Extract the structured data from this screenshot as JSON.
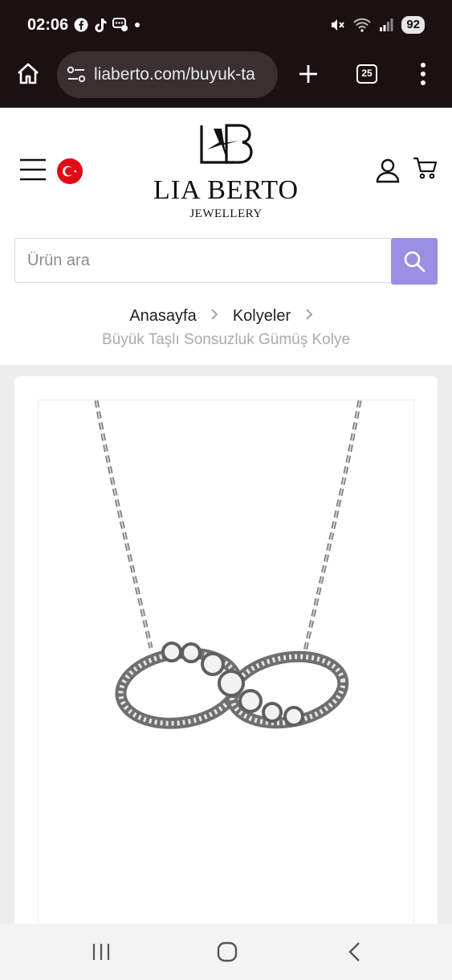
{
  "status_bar": {
    "time": "02:06",
    "battery": "92",
    "left_icons": [
      "facebook-icon",
      "tiktok-icon",
      "chat-icon",
      "dot-icon"
    ],
    "right_icons": [
      "mute-icon",
      "wifi-icon",
      "signal-icon"
    ]
  },
  "browser": {
    "url": "liaberto.com/buyuk-ta",
    "tab_count": "25"
  },
  "header": {
    "brand_name": "LIA BERTO",
    "brand_sub": "JEWELLERY",
    "menu_icon": "hamburger-menu-icon",
    "flag_icon": "turkey-flag-icon",
    "user_icon": "user-icon",
    "cart_icon": "cart-icon"
  },
  "search": {
    "placeholder": "Ürün ara",
    "button_icon": "search-icon"
  },
  "breadcrumb": {
    "items": [
      "Anasayfa",
      "Kolyeler"
    ],
    "current": "Büyük Taşlı Sonsuzluk Gümüş Kolye"
  },
  "product": {
    "image_alt": "Büyük Taşlı Sonsuzluk Gümüş Kolye"
  },
  "colors": {
    "accent": "#9a8fe4",
    "status_bar": "#1c1112",
    "flag": "#e30a17"
  }
}
